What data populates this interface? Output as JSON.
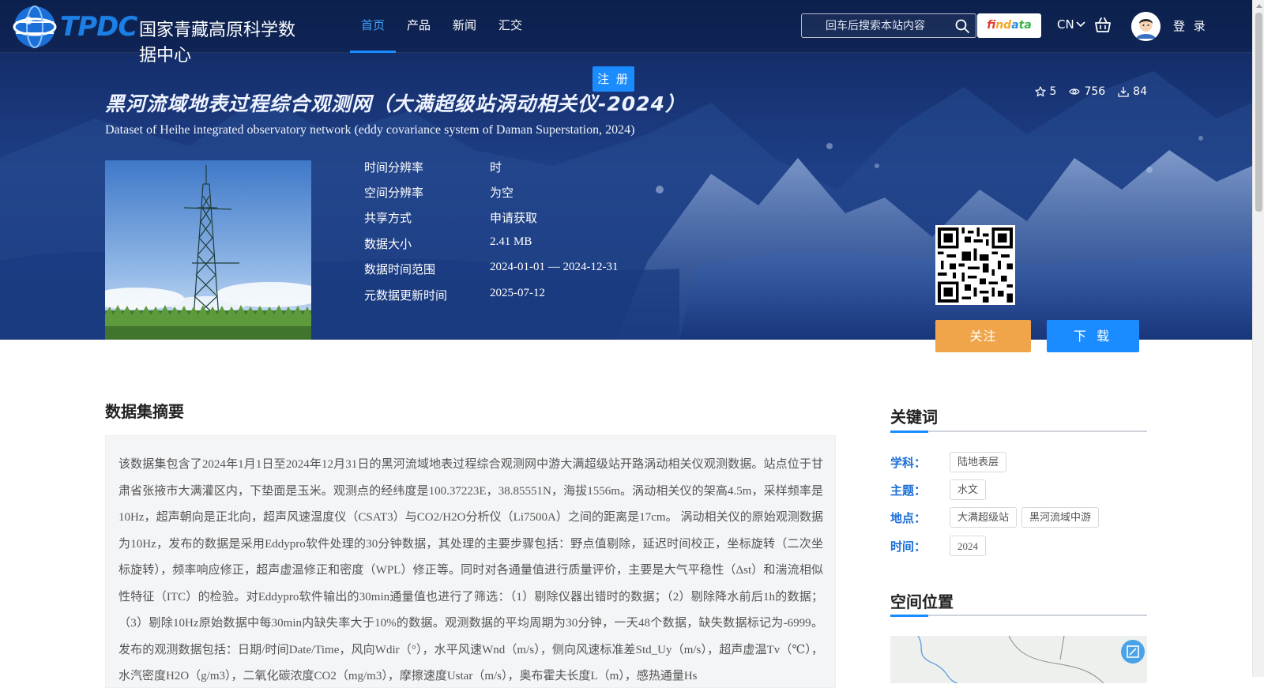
{
  "nav": {
    "logo_tpdc": "TPDC",
    "logo_cn": "国家青藏高原科学数据中心",
    "items": [
      {
        "label": "首页",
        "active": true
      },
      {
        "label": "产品",
        "active": false
      },
      {
        "label": "新闻",
        "active": false
      },
      {
        "label": "汇交",
        "active": false
      }
    ],
    "search_placeholder": "回车后搜索本站内容",
    "findata_letters": [
      "fi",
      "nd",
      "a",
      "ta"
    ],
    "lang": "CN",
    "login": "登 录",
    "register": "注 册"
  },
  "dataset": {
    "title_cn": "黑河流域地表过程综合观测网（大满超级站涡动相关仪-2024）",
    "title_en": "Dataset of Heihe integrated observatory network (eddy covariance system of Daman Superstation, 2024)",
    "stats": {
      "stars": "5",
      "views": "756",
      "downloads": "84"
    },
    "meta": [
      {
        "label": "时间分辨率",
        "value": "时"
      },
      {
        "label": "空间分辨率",
        "value": "为空"
      },
      {
        "label": "共享方式",
        "value": "申请获取"
      },
      {
        "label": "数据大小",
        "value": "2.41 MB"
      },
      {
        "label": "数据时间范围",
        "value": "2024-01-01 — 2024-12-31"
      },
      {
        "label": "元数据更新时间",
        "value": "2025-07-12"
      }
    ],
    "follow_label": "关注",
    "download_label": "下 载"
  },
  "abstract": {
    "heading": "数据集摘要",
    "text": "该数据集包含了2024年1月1日至2024年12月31日的黑河流域地表过程综合观测网中游大满超级站开路涡动相关仪观测数据。站点位于甘肃省张掖市大满灌区内，下垫面是玉米。观测点的经纬度是100.37223E，38.85551N，海拔1556m。涡动相关仪的架高4.5m，采样频率是10Hz，超声朝向是正北向，超声风速温度仪（CSAT3）与CO2/H2O分析仪（Li7500A）之间的距离是17cm。 涡动相关仪的原始观测数据为10Hz，发布的数据是采用Eddypro软件处理的30分钟数据，其处理的主要步骤包括：野点值剔除，延迟时间校正，坐标旋转（二次坐标旋转），频率响应修正，超声虚温修正和密度（WPL）修正等。同时对各通量值进行质量评价，主要是大气平稳性（Δst）和湍流相似性特征（ITC）的检验。对Eddypro软件输出的30min通量值也进行了筛选：（1）剔除仪器出错时的数据；（2）剔除降水前后1h的数据；（3）剔除10Hz原始数据中每30min内缺失率大于10%的数据。观测数据的平均周期为30分钟，一天48个数据，缺失数据标记为-6999。 发布的观测数据包括：日期/时间Date/Time，风向Wdir（°），水平风速Wnd（m/s），侧向风速标准差Std_Uy（m/s），超声虚温Tv（℃），水汽密度H2O（g/m3），二氧化碳浓度CO2（mg/m3），摩擦速度Ustar（m/s），奥布霍夫长度L（m），感热通量Hs"
  },
  "sidebar": {
    "keywords_heading": "关键词",
    "keywords": [
      {
        "label": "学科：",
        "tags": [
          "陆地表层"
        ]
      },
      {
        "label": "主题：",
        "tags": [
          "水文"
        ]
      },
      {
        "label": "地点：",
        "tags": [
          "大满超级站",
          "黑河流域中游"
        ]
      },
      {
        "label": "时间：",
        "tags": [
          "2024"
        ]
      }
    ],
    "location_heading": "空间位置"
  },
  "colors": {
    "accent": "#1a8cff",
    "follow": "#f0a54a",
    "keyword_label": "#1a6ed8"
  }
}
